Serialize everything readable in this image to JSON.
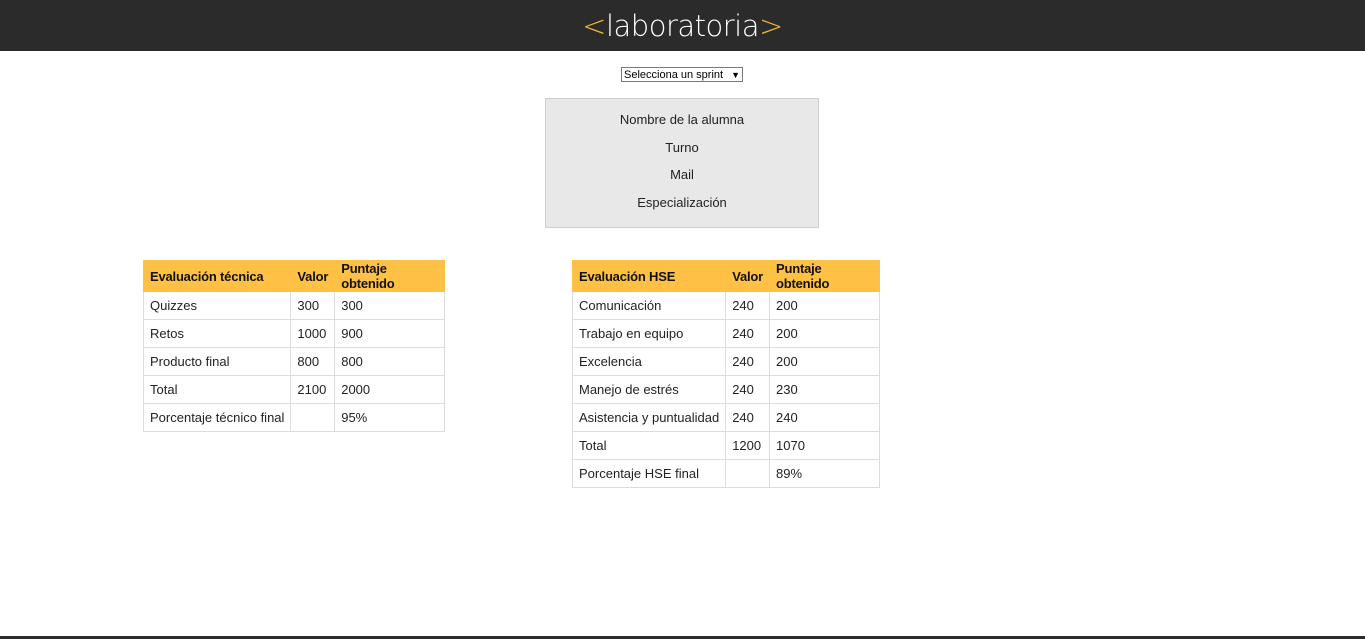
{
  "header": {
    "logo_left_bracket": "<",
    "logo_word": "laboratoria",
    "logo_right_bracket": ">"
  },
  "sprint_select": {
    "selected": "Selecciona un sprint",
    "caret": "▼"
  },
  "student": {
    "name": "Nombre de la alumna",
    "shift": "Turno",
    "mail": "Mail",
    "specialization": "Especialización"
  },
  "tech_table": {
    "headers": [
      "Evaluación técnica",
      "Valor",
      "Puntaje obtenido"
    ],
    "rows": [
      [
        "Quizzes",
        "300",
        "300"
      ],
      [
        "Retos",
        "1000",
        "900"
      ],
      [
        "Producto final",
        "800",
        "800"
      ],
      [
        "Total",
        "2100",
        "2000"
      ],
      [
        "Porcentaje técnico final",
        "",
        "95%"
      ]
    ]
  },
  "hse_table": {
    "headers": [
      "Evaluación HSE",
      "Valor",
      "Puntaje obtenido"
    ],
    "rows": [
      [
        "Comunicación",
        "240",
        "200"
      ],
      [
        "Trabajo en equipo",
        "240",
        "200"
      ],
      [
        "Excelencia",
        "240",
        "200"
      ],
      [
        "Manejo de estrés",
        "240",
        "230"
      ],
      [
        "Asistencia y puntualidad",
        "240",
        "240"
      ],
      [
        "Total",
        "1200",
        "1070"
      ],
      [
        "Porcentaje HSE final",
        "",
        "89%"
      ]
    ]
  },
  "colors": {
    "header_bg": "#2b2b2b",
    "accent": "#f0b632",
    "table_header": "#ffc145",
    "card_bg": "#e8e8e8"
  }
}
